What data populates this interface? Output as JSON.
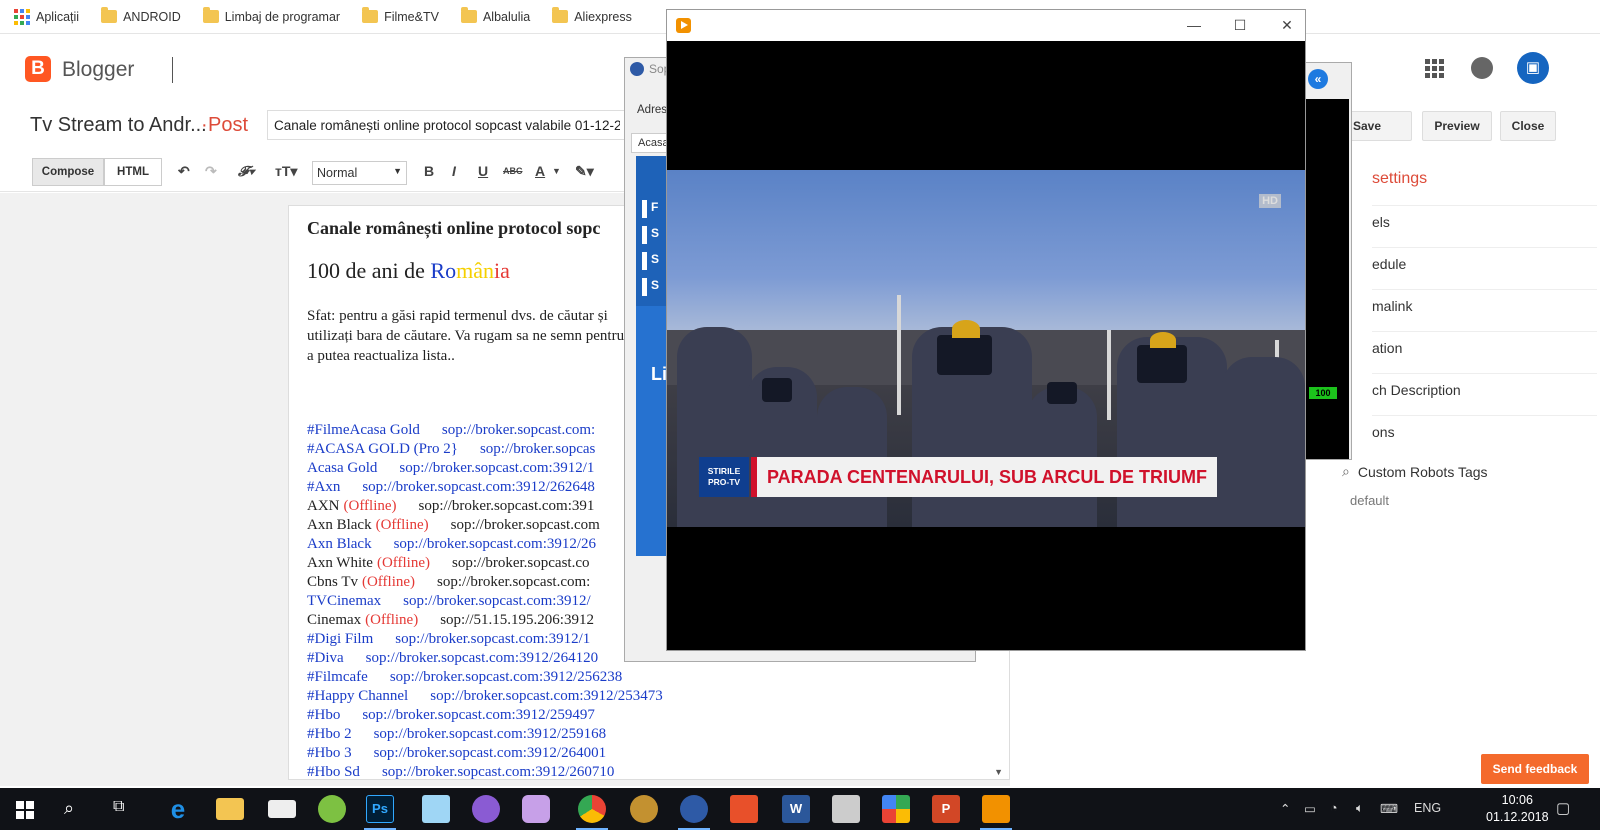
{
  "bookmarks": [
    {
      "label": "Aplicații",
      "icon": "apps-grid-icon"
    },
    {
      "label": "ANDROID",
      "icon": "folder-icon"
    },
    {
      "label": "Limbaj de programar",
      "icon": "folder-icon"
    },
    {
      "label": "Filme&TV",
      "icon": "folder-icon"
    },
    {
      "label": "Albalulia",
      "icon": "folder-icon"
    },
    {
      "label": "Aliexpress",
      "icon": "folder-icon"
    }
  ],
  "header": {
    "app_name": "Blogger",
    "logo_letter": "B",
    "brand_color": "#ff5722"
  },
  "title_row": {
    "blog_title": "Tv Stream to Andr...",
    "separator": "·",
    "post_label": "Post",
    "post_title": "Canale românești online protocol sopcast valabile 01-12-2",
    "buttons": {
      "save": "Save",
      "preview": "Preview",
      "close": "Close"
    }
  },
  "toolbar": {
    "compose": "Compose",
    "html": "HTML",
    "format": "Normal",
    "bold": "B",
    "italic": "I",
    "underline": "U",
    "strike": "ABC",
    "color": "A"
  },
  "editor": {
    "heading": "Canale românești online protocol sopc",
    "century_prefix": "100 de ani de ",
    "country": {
      "r1": "Ro",
      "r2": "mân",
      "r3": "ia"
    },
    "tip": "Sfat: pentru a găsi rapid termenul dvs. de căutar și utilizați bara de căutare. Va rugam sa ne semn pentru a putea reactualiza lista..",
    "channels": [
      {
        "name": "#FilmeAcasa Gold",
        "offline": "",
        "url": "sop://broker.sopcast.com:",
        "plain": false
      },
      {
        "name": "#ACASA GOLD (Pro 2}",
        "offline": "",
        "url": "sop://broker.sopcas",
        "plain": false
      },
      {
        "name": "Acasa Gold",
        "offline": "",
        "url": "sop://broker.sopcast.com:3912/1",
        "plain": false
      },
      {
        "name": "#Axn",
        "offline": "",
        "url": "sop://broker.sopcast.com:3912/262648",
        "plain": false
      },
      {
        "name": "AXN",
        "offline": "(Offline)",
        "url": "sop://broker.sopcast.com:391",
        "plain": true
      },
      {
        "name": "Axn Black",
        "offline": "(Offline)",
        "url": "sop://broker.sopcast.com",
        "plain": true
      },
      {
        "name": "Axn Black",
        "offline": "",
        "url": "sop://broker.sopcast.com:3912/26",
        "plain": false
      },
      {
        "name": "Axn White",
        "offline": "(Offline)",
        "url": "sop://broker.sopcast.co",
        "plain": true
      },
      {
        "name": "Cbns Tv",
        "offline": "(Offline)",
        "url": "sop://broker.sopcast.com:",
        "plain": true
      },
      {
        "name": "TVCinemax",
        "offline": "",
        "url": "sop://broker.sopcast.com:3912/",
        "plain": false
      },
      {
        "name": "Cinemax",
        "offline": "(Offline)",
        "url": "sop://51.15.195.206:3912",
        "plain": true
      },
      {
        "name": "#Digi Film",
        "offline": "",
        "url": "sop://broker.sopcast.com:3912/1",
        "plain": false
      },
      {
        "name": "#Diva",
        "offline": "",
        "url": "sop://broker.sopcast.com:3912/264120",
        "plain": false
      },
      {
        "name": "#Filmcafe",
        "offline": "",
        "url": "sop://broker.sopcast.com:3912/256238",
        "plain": false
      },
      {
        "name": "#Happy Channel",
        "offline": "",
        "url": "sop://broker.sopcast.com:3912/253473",
        "plain": false
      },
      {
        "name": "#Hbo",
        "offline": "",
        "url": "sop://broker.sopcast.com:3912/259497",
        "plain": false
      },
      {
        "name": "#Hbo 2",
        "offline": "",
        "url": "sop://broker.sopcast.com:3912/259168",
        "plain": false
      },
      {
        "name": "#Hbo 3",
        "offline": "",
        "url": "sop://broker.sopcast.com:3912/264001",
        "plain": false
      },
      {
        "name": "#Hbo Sd",
        "offline": "",
        "url": "sop://broker.sopcast.com:3912/260710",
        "plain": false
      }
    ]
  },
  "sidebar": {
    "heading": "settings",
    "items": [
      "els",
      "edule",
      "malink",
      "ation",
      "ch Description",
      "ons"
    ],
    "robots_label": "Custom Robots Tags",
    "robots_value": "default",
    "feedback": "Send feedback"
  },
  "sopcast_window": {
    "title": "Sop",
    "address_label": "Adres",
    "tab": "Acasa",
    "items": [
      "F",
      "S",
      "S",
      "S"
    ],
    "side_text": "Li"
  },
  "second_player": {
    "quality": "100"
  },
  "player": {
    "hd_badge": "HD",
    "channel_logo_line1": "STIRILE",
    "channel_logo_line2": "PRO-TV",
    "lower_third": "PARADA CENTENARULUI, SUB ARCUL DE TRIUMF"
  },
  "taskbar": {
    "language": "ENG",
    "time": "10:06",
    "date": "01.12.2018",
    "ps_label": "Ps"
  }
}
